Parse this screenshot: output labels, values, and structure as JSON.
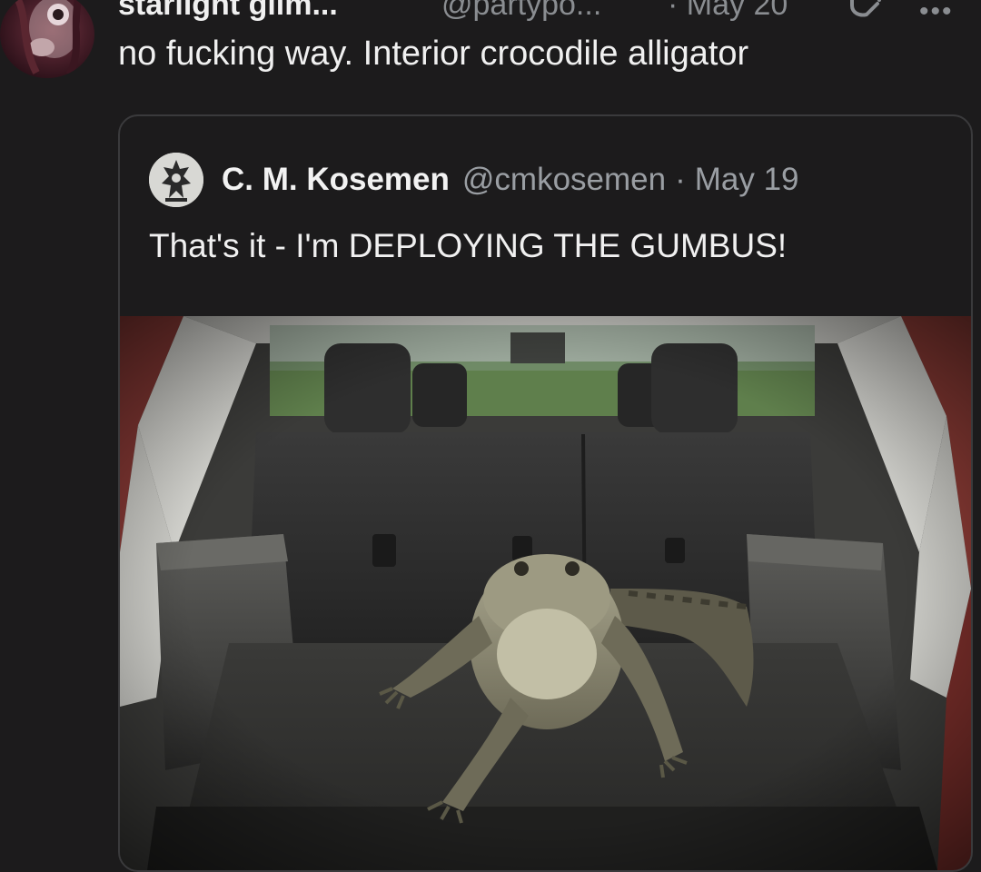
{
  "reply": {
    "author_name": "starlight glim...",
    "author_handle": "@partypo...",
    "date": "· May 20",
    "text": "no fucking way. Interior crocodile alligator"
  },
  "quoted": {
    "author_name": "C. M. Kosemen",
    "author_handle": "@cmkosemen",
    "separator": "·",
    "date": "May 19",
    "text": "That's it - I'm DEPLOYING THE GUMBUS!"
  },
  "icons": {
    "grok": "grok-icon",
    "more": "more-icon"
  },
  "colors": {
    "background": "#1c1b1c",
    "muted_text": "#8a8d91",
    "card_border": "#3a3a3c"
  }
}
